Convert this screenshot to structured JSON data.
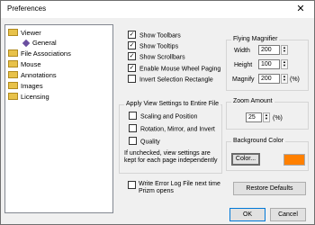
{
  "window": {
    "title": "Preferences",
    "close": "✕"
  },
  "tree": [
    {
      "label": "Viewer"
    },
    {
      "label": "General"
    },
    {
      "label": "File Associations"
    },
    {
      "label": "Mouse"
    },
    {
      "label": "Annotations"
    },
    {
      "label": "Images"
    },
    {
      "label": "Licensing"
    }
  ],
  "options": {
    "show_toolbars": "Show Toolbars",
    "show_tooltips": "Show Tooltips",
    "show_scrollbars": "Show Scrollbars",
    "enable_wheel": "Enable Mouse Wheel Paging",
    "invert_selection": "Invert Selection Rectangle"
  },
  "apply_group": {
    "title": "Apply View Settings to Entire File",
    "scaling": "Scaling and Position",
    "rotation": "Rotation, Mirror, and Invert",
    "quality": "Quality",
    "note": "If unchecked, view settings are kept for each page independently"
  },
  "magnifier": {
    "title": "Flying Magnifier",
    "width_label": "Width",
    "width_value": "200",
    "height_label": "Height",
    "height_value": "100",
    "magnify_label": "Magnify",
    "magnify_value": "200",
    "pct": "(%)"
  },
  "zoom": {
    "title": "Zoom Amount",
    "value": "25",
    "pct": "(%)"
  },
  "background": {
    "title": "Background Color",
    "color_button": "Color...",
    "swatch_color": "#ff8000"
  },
  "error_log": {
    "label": "Write Error Log File next time Prizm opens"
  },
  "buttons": {
    "restore": "Restore Defaults",
    "ok": "OK",
    "cancel": "Cancel"
  }
}
